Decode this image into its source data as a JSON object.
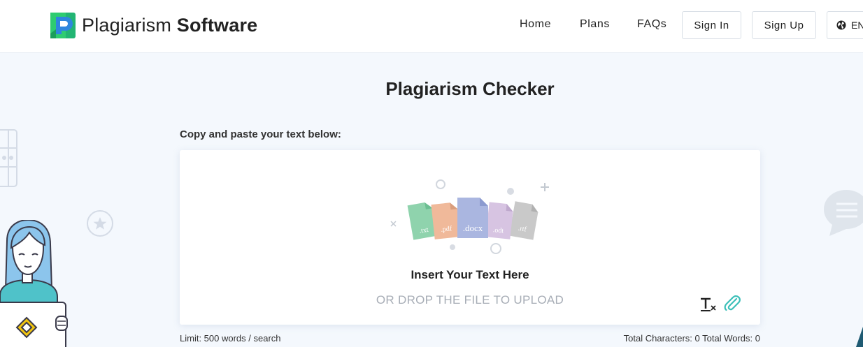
{
  "header": {
    "logo_light": "Plagiarism",
    "logo_bold": "Software",
    "nav": [
      {
        "label": "Home"
      },
      {
        "label": "Plans"
      },
      {
        "label": "FAQs"
      }
    ],
    "sign_in": "Sign In",
    "sign_up": "Sign Up",
    "language": "EN"
  },
  "main": {
    "title": "Plagiarism Checker",
    "instruction": "Copy and paste your text below:",
    "editor": {
      "file_types": [
        ".txt",
        ".pdf",
        ".docx",
        ".odt",
        ".rtf"
      ],
      "insert_label": "Insert Your Text Here",
      "drop_label": "OR DROP THE FILE TO UPLOAD"
    },
    "limit": "Limit: 500 words / search",
    "counts": "Total Characters: 0 Total Words: 0"
  },
  "colors": {
    "accent_teal": "#3bbfb8",
    "logo_blue": "#2e86de",
    "logo_green": "#2ecc71",
    "txt_file": "#8fd3ad",
    "pdf_file": "#f0b99a",
    "docx_file": "#aab6e0",
    "odt_file": "#d7c4e2",
    "rtf_file": "#c9c9c9"
  }
}
